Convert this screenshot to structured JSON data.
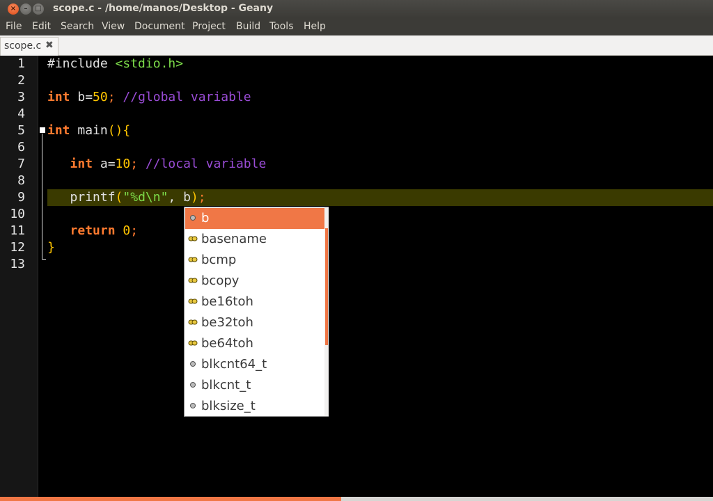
{
  "window": {
    "title": "scope.c - /home/manos/Desktop - Geany",
    "close_glyph": "×",
    "min_glyph": "–",
    "max_glyph": "□"
  },
  "menu": [
    "File",
    "Edit",
    "Search",
    "View",
    "Document",
    "Project",
    "Build",
    "Tools",
    "Help"
  ],
  "tab": {
    "label": "scope.c",
    "close_glyph": "✖"
  },
  "line_numbers": [
    "1",
    "2",
    "3",
    "4",
    "5",
    "6",
    "7",
    "8",
    "9",
    "10",
    "11",
    "12",
    "13"
  ],
  "code": {
    "l1_pp": "#include ",
    "l1_inc": "<stdio.h>",
    "l3_kw": "int",
    "l3_id": " b=",
    "l3_num": "50",
    "l3_semi": ";",
    "l3_cmt": " //global variable",
    "l5_kw": "int",
    "l5_id": " main",
    "l5_paren": "()",
    "l5_brace": "{",
    "l7_indent": "   ",
    "l7_kw": "int",
    "l7_id": " a=",
    "l7_num": "10",
    "l7_semi": ";",
    "l7_cmt": " //local variable",
    "l9_indent": "   ",
    "l9_fn": "printf",
    "l9_open": "(",
    "l9_str": "\"%d\\n\"",
    "l9_rest": ", b",
    "l9_close": ")",
    "l9_semi": ";",
    "l11_indent": "   ",
    "l11_kw": "return",
    "l11_sp": " ",
    "l11_num": "0",
    "l11_semi": ";",
    "l12_brace": "}"
  },
  "autocomplete": {
    "items": [
      {
        "label": "b",
        "icon": "variable-icon",
        "selected": true
      },
      {
        "label": "basename",
        "icon": "function-icon"
      },
      {
        "label": "bcmp",
        "icon": "function-icon"
      },
      {
        "label": "bcopy",
        "icon": "function-icon"
      },
      {
        "label": "be16toh",
        "icon": "function-icon"
      },
      {
        "label": "be32toh",
        "icon": "function-icon"
      },
      {
        "label": "be64toh",
        "icon": "function-icon"
      },
      {
        "label": "blkcnt64_t",
        "icon": "type-icon"
      },
      {
        "label": "blkcnt_t",
        "icon": "type-icon"
      },
      {
        "label": "blksize_t",
        "icon": "type-icon"
      }
    ]
  },
  "colors": {
    "accent": "#f07746",
    "keyword": "#ff7a2f",
    "number": "#ffc500",
    "string": "#7ddc4a",
    "comment": "#9a4cd6"
  }
}
